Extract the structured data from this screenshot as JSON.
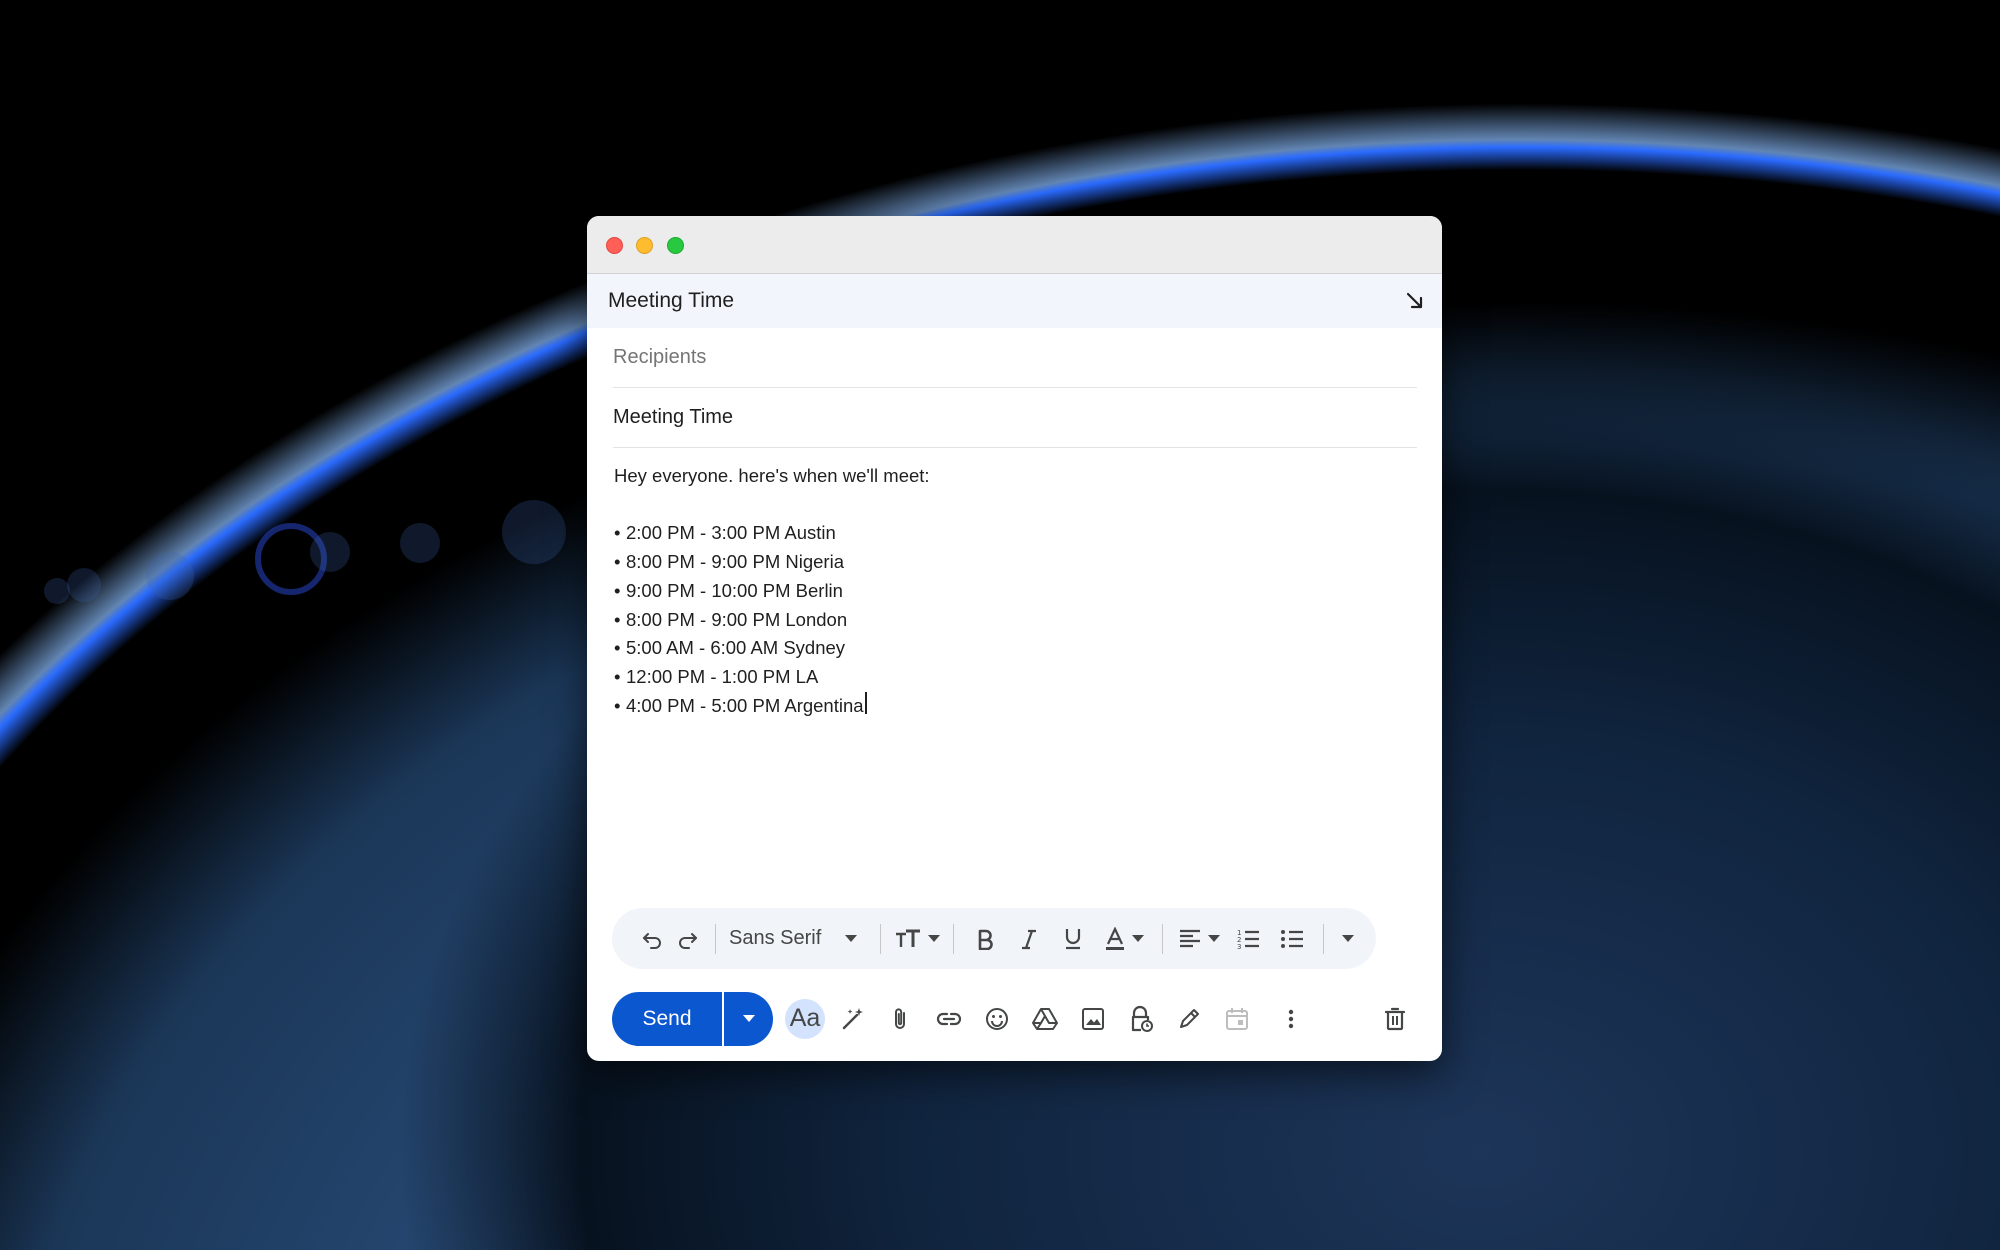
{
  "window": {
    "header_title": "Meeting Time"
  },
  "compose": {
    "recipients_placeholder": "Recipients",
    "subject": "Meeting Time",
    "body_greeting": "Hey everyone. here's when we'll meet:",
    "bullets": [
      "2:00 PM - 3:00 PM Austin",
      "8:00 PM - 9:00 PM Nigeria",
      "9:00 PM - 10:00 PM Berlin",
      "8:00 PM - 9:00 PM London",
      "5:00 AM - 6:00 AM Sydney",
      "12:00 PM - 1:00 PM LA",
      "4:00 PM - 5:00 PM Argentina"
    ]
  },
  "format_toolbar": {
    "font": "Sans Serif",
    "icons": [
      "undo-icon",
      "redo-icon",
      "font-size-icon",
      "bold-icon",
      "italic-icon",
      "underline-icon",
      "text-color-icon",
      "align-icon",
      "numbered-list-icon",
      "bulleted-list-icon",
      "more-formatting-icon"
    ]
  },
  "bottom_bar": {
    "send_label": "Send",
    "aa_label": "Aa",
    "icons": [
      "formatting-toggle-icon",
      "magic-pen-icon",
      "paperclip-icon",
      "link-icon",
      "emoji-icon",
      "drive-icon",
      "image-icon",
      "confidential-lock-icon",
      "signature-pen-icon",
      "schedule-calendar-icon",
      "more-options-icon",
      "trash-icon"
    ]
  },
  "colors": {
    "send_blue": "#0b57d0",
    "header_bg": "#f2f6fc",
    "toolbar_bg": "#f1f4f9",
    "aa_bg": "#d3e3fd"
  }
}
